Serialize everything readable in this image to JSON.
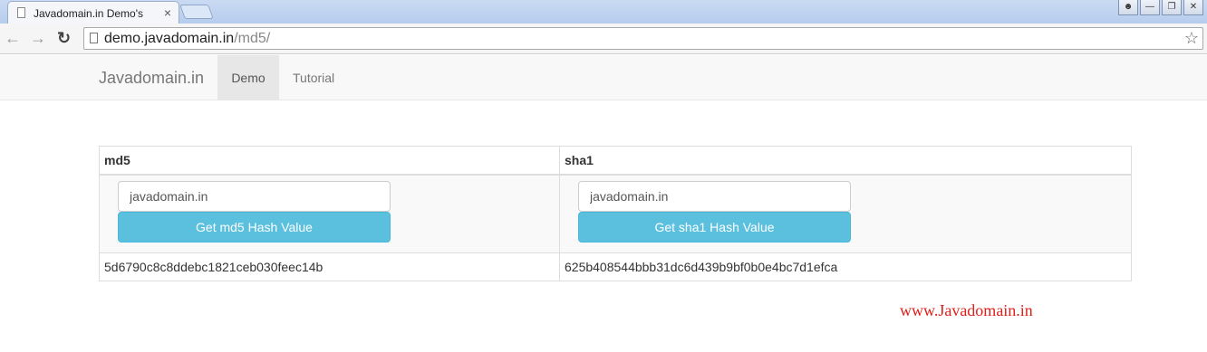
{
  "browser": {
    "tab_title": "Javadomain.in Demo's",
    "tab_close": "×",
    "url_host": "demo.javadomain.in",
    "url_path": "/md5/",
    "back_icon": "arrow-left-icon",
    "forward_icon": "arrow-right-icon",
    "reload_icon": "reload-icon",
    "star_icon": "star-icon"
  },
  "navbar": {
    "brand": "Javadomain.in",
    "items": [
      {
        "label": "Demo",
        "active": true
      },
      {
        "label": "Tutorial",
        "active": false
      }
    ]
  },
  "table": {
    "headers": [
      "md5",
      "sha1"
    ],
    "md5": {
      "input_value": "javadomain.in",
      "button_label": "Get md5 Hash Value",
      "hash": "5d6790c8c8ddebc1821ceb030feec14b"
    },
    "sha1": {
      "input_value": "javadomain.in",
      "button_label": "Get sha1 Hash Value",
      "hash": "625b408544bbb31dc6d439b9bf0b0e4bc7d1efca"
    }
  },
  "watermark": "www.Javadomain.in",
  "colors": {
    "button_bg": "#5bc0de",
    "watermark": "#e0201a"
  }
}
